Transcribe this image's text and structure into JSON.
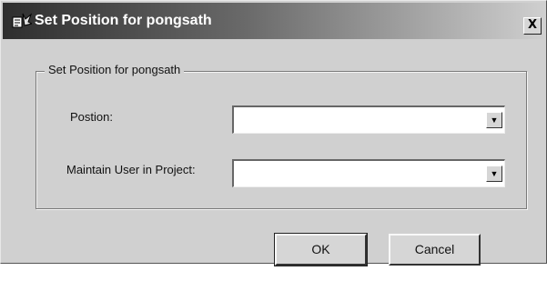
{
  "window": {
    "title": "Set Position for pongsath",
    "close_glyph": "X"
  },
  "group": {
    "legend": "Set Position for pongsath"
  },
  "fields": {
    "position": {
      "label": "Postion:",
      "value": ""
    },
    "maintain_user": {
      "label": "Maintain User in Project:",
      "value": ""
    }
  },
  "buttons": {
    "ok_label": "OK",
    "cancel_label": "Cancel"
  },
  "icons": {
    "app": "app-icon",
    "dropdown": "chevron-down-icon"
  },
  "colors": {
    "dialog_bg": "#d0d0d0",
    "titlebar_dark": "#2e2e2e",
    "titlebar_light": "#cfcfcf"
  }
}
